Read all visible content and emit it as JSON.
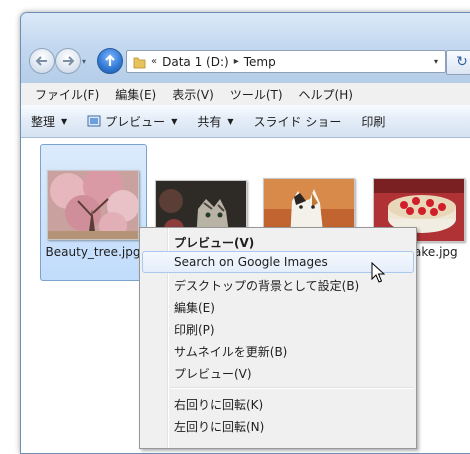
{
  "address": {
    "overflow_chevron": "«",
    "separator": "▸",
    "crumbs": [
      "Data 1 (D:)",
      "Temp"
    ],
    "dropdown_glyph": "▾",
    "refresh_glyph": "↻"
  },
  "nav": {
    "back_icon": "back-arrow-icon",
    "forward_icon": "forward-arrow-icon",
    "up_icon": "up-arrow-icon",
    "history_dropdown_glyph": "▾"
  },
  "menubar": {
    "items": [
      "ファイル(F)",
      "編集(E)",
      "表示(V)",
      "ツール(T)",
      "ヘルプ(H)"
    ]
  },
  "toolbar": {
    "caret": "▼",
    "items": [
      {
        "label": "整理",
        "has_dropdown": true
      },
      {
        "label": "プレビュー",
        "has_dropdown": true,
        "icon": "preview-icon"
      },
      {
        "label": "共有",
        "has_dropdown": true
      },
      {
        "label": "スライド ショー",
        "has_dropdown": false
      },
      {
        "label": "印刷",
        "has_dropdown": false
      }
    ]
  },
  "files": [
    {
      "name": "Beauty_tree.jpg",
      "selected": true,
      "subject": "pink blossom tree"
    },
    {
      "name": "",
      "selected": false,
      "subject": "tabby cat"
    },
    {
      "name": "",
      "selected": false,
      "subject": "calico cat"
    },
    {
      "name": "ake.jpg",
      "selected": false,
      "subject": "strawberry cake"
    }
  ],
  "context_menu": {
    "items": [
      {
        "label": "プレビュー(V)",
        "bold": true
      },
      {
        "label": "Search on Google Images",
        "hover": true
      },
      {
        "label": "デスクトップの背景として設定(B)"
      },
      {
        "label": "編集(E)"
      },
      {
        "label": "印刷(P)"
      },
      {
        "label": "サムネイルを更新(B)"
      },
      {
        "label": "プレビュー(V)"
      },
      {
        "separator": true
      },
      {
        "label": "右回りに回転(K)"
      },
      {
        "label": "左回りに回転(N)"
      }
    ]
  },
  "colors": {
    "window_frame": "#cfe0f2",
    "selection_fill": "#c1dcfc",
    "menu_hover_border": "#a8c8ee",
    "menu_bg": "#f0f0f0"
  }
}
